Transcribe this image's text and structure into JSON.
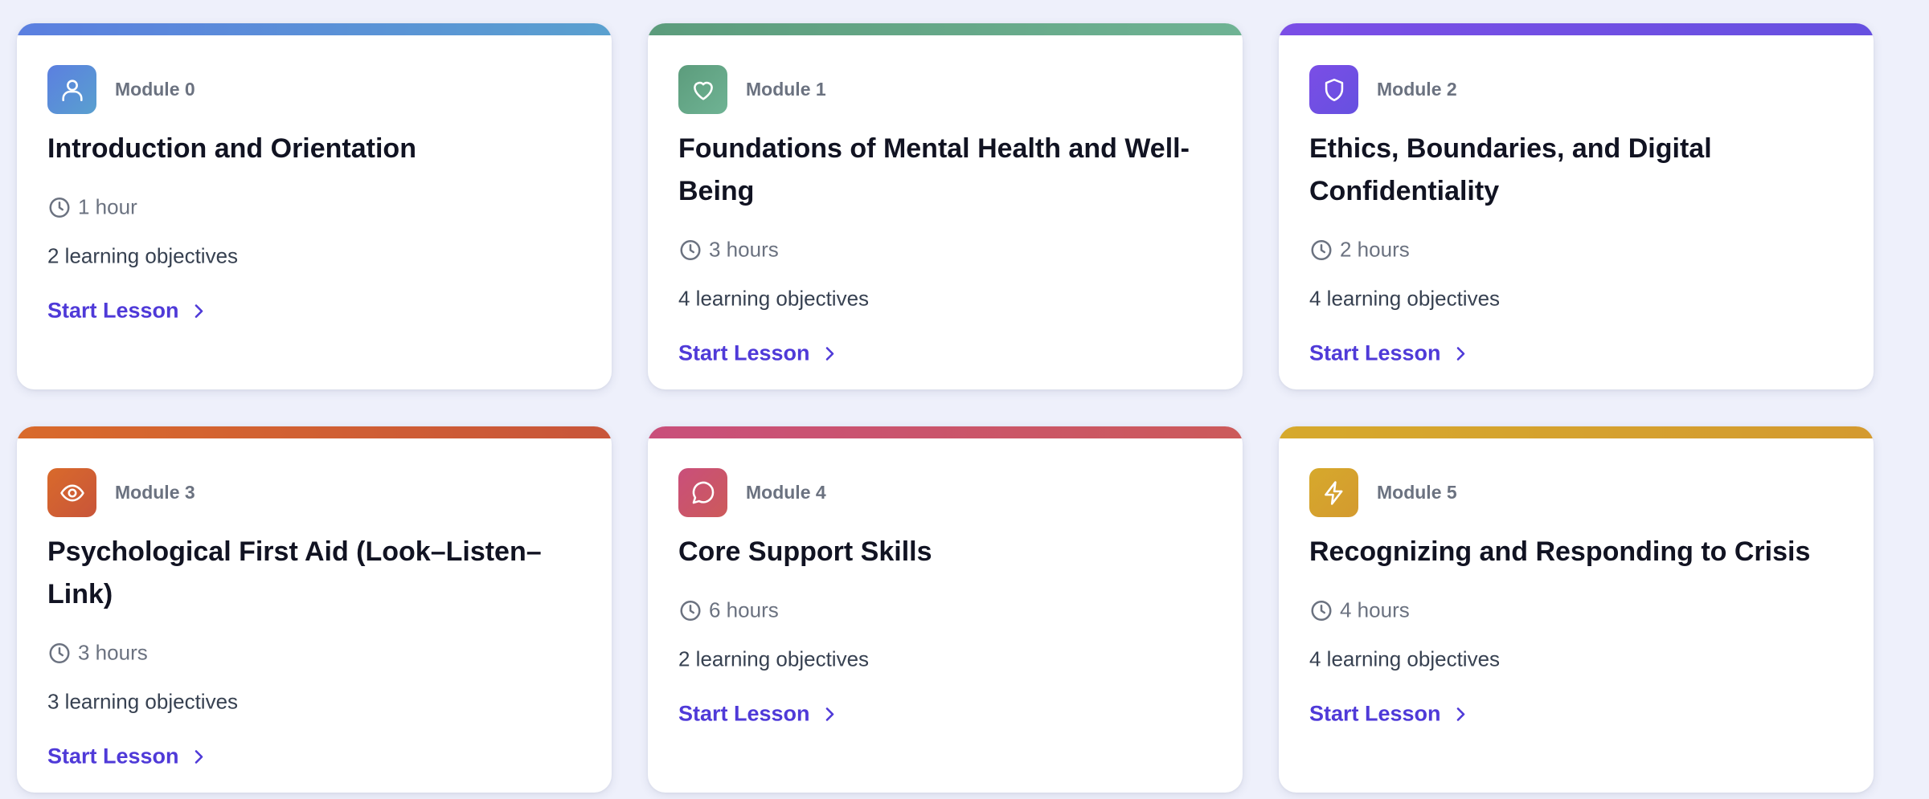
{
  "modules": [
    {
      "label": "Module 0",
      "title": "Introduction and Orientation",
      "duration": "1 hour",
      "objectives": "2 learning objectives",
      "cta": "Start Lesson",
      "icon": "user-icon",
      "gradient": [
        "#5b7fe0",
        "#5aa0cf"
      ]
    },
    {
      "label": "Module 1",
      "title": "Foundations of Mental Health and Well-Being",
      "duration": "3 hours",
      "objectives": "4 learning objectives",
      "cta": "Start Lesson",
      "icon": "heart-icon",
      "gradient": [
        "#5c9c7c",
        "#6fb394"
      ]
    },
    {
      "label": "Module 2",
      "title": "Ethics, Boundaries, and Digital Confidentiality",
      "duration": "2 hours",
      "objectives": "4 learning objectives",
      "cta": "Start Lesson",
      "icon": "shield-icon",
      "gradient": [
        "#7b4ee6",
        "#6650e0"
      ]
    },
    {
      "label": "Module 3",
      "title": "Psychological First Aid (Look–Listen–Link)",
      "duration": "3 hours",
      "objectives": "3 learning objectives",
      "cta": "Start Lesson",
      "icon": "eye-icon",
      "gradient": [
        "#d96a2b",
        "#c8553a"
      ]
    },
    {
      "label": "Module 4",
      "title": "Core Support Skills",
      "duration": "6 hours",
      "objectives": "2 learning objectives",
      "cta": "Start Lesson",
      "icon": "message-circle-icon",
      "gradient": [
        "#c94f7b",
        "#cc5a5a"
      ]
    },
    {
      "label": "Module 5",
      "title": "Recognizing and Responding to Crisis",
      "duration": "4 hours",
      "objectives": "4 learning objectives",
      "cta": "Start Lesson",
      "icon": "lightning-icon",
      "gradient": [
        "#d6a92c",
        "#d49a2f"
      ]
    }
  ]
}
